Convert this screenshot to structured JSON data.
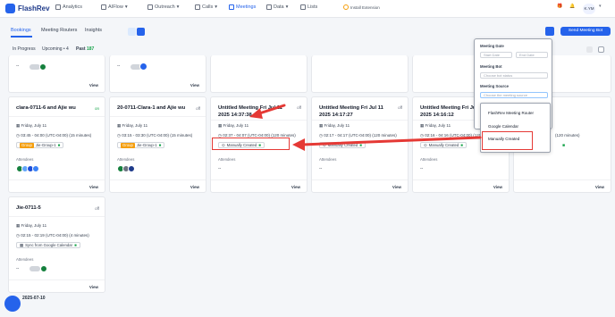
{
  "app": {
    "logo": "FlashRev"
  },
  "nav": [
    {
      "label": "Analytics"
    },
    {
      "label": "AIFlow"
    },
    {
      "label": "Outreach"
    },
    {
      "label": "Calls"
    },
    {
      "label": "Meetings"
    },
    {
      "label": "Data"
    },
    {
      "label": "Lists"
    }
  ],
  "install_ext": "Install Extension",
  "user_initials": "K.YM",
  "tabs": [
    {
      "label": "Bookings"
    },
    {
      "label": "Meeting Routers"
    },
    {
      "label": "Insights"
    }
  ],
  "segments": {
    "in_progress": "In Progress",
    "upcoming": "Upcoming",
    "upcoming_count": "4",
    "past": "Past",
    "past_count": "187"
  },
  "send_button": "Send Meeting Bot",
  "cards": [
    {
      "title": "clara-0711-6 and Ajie wu",
      "status": "on",
      "date": "Friday, July 11",
      "time": "03:45 - 04:00 (UTC-04:00) (15 minutes)",
      "group": "Group",
      "group_name": "Jie-Group-1",
      "attendees_label": "Attendees",
      "view": "View"
    },
    {
      "title": "20-0711-Clara-1 and Ajie wu",
      "status": "off",
      "date": "Friday, July 11",
      "time": "03:15 - 03:30 (UTC-04:00) (15 minutes)",
      "group": "Group",
      "group_name": "Jie-Group-1",
      "attendees_label": "Attendees",
      "view": "View"
    },
    {
      "title": "Untitled Meeting Fri Jul 11 2025 14:37:38",
      "status": "off",
      "date": "Friday, July 11",
      "time": "02:37 - 04:07 (UTC-04:00) (120 minutes)",
      "source": "Manually Created",
      "attendees_label": "Attendees",
      "dash": "--",
      "view": "View"
    },
    {
      "title": "Untitled Meeting Fri Jul 11 2025 14:17:27",
      "status": "off",
      "date": "Friday, July 11",
      "time": "02:17 - 04:17 (UTC-04:00) (120 minutes)",
      "source": "Manually Created",
      "attendees_label": "Attendees",
      "dash": "--",
      "view": "View"
    },
    {
      "title": "Untitled Meeting Fri Jul 11 2025 14:16:12",
      "status": "off",
      "date": "Friday, July 11",
      "time": "02:16 - 04:16 (UTC-04:00) (120 minutes)",
      "source": "Manually Created",
      "attendees_label": "Attendees",
      "dash": "--",
      "view": "View"
    },
    {
      "title": "Jie-0711-5",
      "status": "off",
      "date": "Friday, July 11",
      "time": "02:15 - 02:19 (UTC-04:00) (4 minutes)",
      "source": "Sync from Google Calendar",
      "attendees_label": "Attendees",
      "dash": "--",
      "view": "View"
    }
  ],
  "partial_time": "(120 minutes)",
  "top_row_views": [
    "View",
    "View"
  ],
  "filter": {
    "meeting_date_label": "Meeting Date",
    "start_placeholder": "Start Date",
    "end_placeholder": "End Date",
    "meeting_bot_label": "Meeting Bot",
    "bot_placeholder": "Choose bot status",
    "meeting_source_label": "Meeting Source",
    "source_placeholder": "Choose the meeting source",
    "options": [
      "FlashRev Meeting Router",
      "Google Calendar",
      "Manually Created"
    ]
  },
  "date_divider": "2025-07-10",
  "colors": {
    "primary": "#2563eb",
    "annotation": "#e53935",
    "on": "#16a34a"
  }
}
